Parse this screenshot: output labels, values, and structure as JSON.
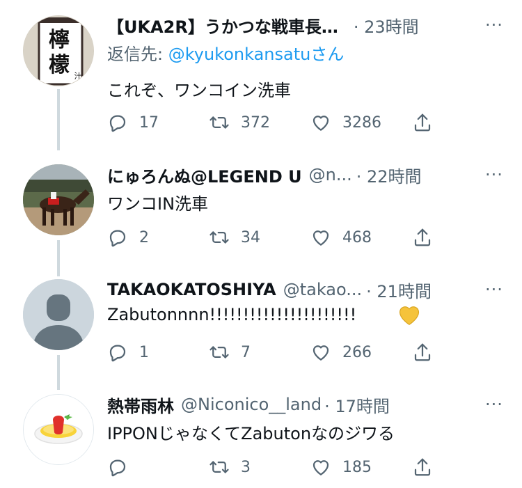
{
  "tweets": [
    {
      "display_name": "【UKA2R】うかつな戦車長…",
      "handle": "",
      "time": "· 23時間",
      "reply_prefix": "返信先: ",
      "reply_mention": "@kyukonkansatu",
      "reply_suffix": "さん",
      "text": "これぞ、ワンコイン洗車",
      "avatar_text": [
        "檸",
        "檬",
        "汁"
      ],
      "replies": "17",
      "retweets": "372",
      "likes": "3286"
    },
    {
      "display_name": "にゅろんぬ@LEGEND U",
      "handle": "@n...",
      "time": "· 22時間",
      "text": "ワンコIN洗車",
      "replies": "2",
      "retweets": "34",
      "likes": "468"
    },
    {
      "display_name": "TAKAOKATOSHIYA",
      "handle": "@takao...",
      "time": "· 21時間",
      "text": "Zabutonnnn!!!!!!!!!!!!!!!!!!!!!!",
      "emoji": "yellow-heart-icon",
      "replies": "1",
      "retweets": "7",
      "likes": "266"
    },
    {
      "display_name": "熱帯雨林",
      "handle": "@Niconico__land",
      "time": "· 17時間",
      "text": "IPPONじゃなくてZabutonなのジワる",
      "replies": "",
      "retweets": "3",
      "likes": "185"
    }
  ],
  "more_label": "···",
  "colors": {
    "text": "#0f1419",
    "secondary": "#536471",
    "link": "#1d9bf0",
    "thread_line": "#cfd9de",
    "emoji_heart": "#f5c33b"
  }
}
